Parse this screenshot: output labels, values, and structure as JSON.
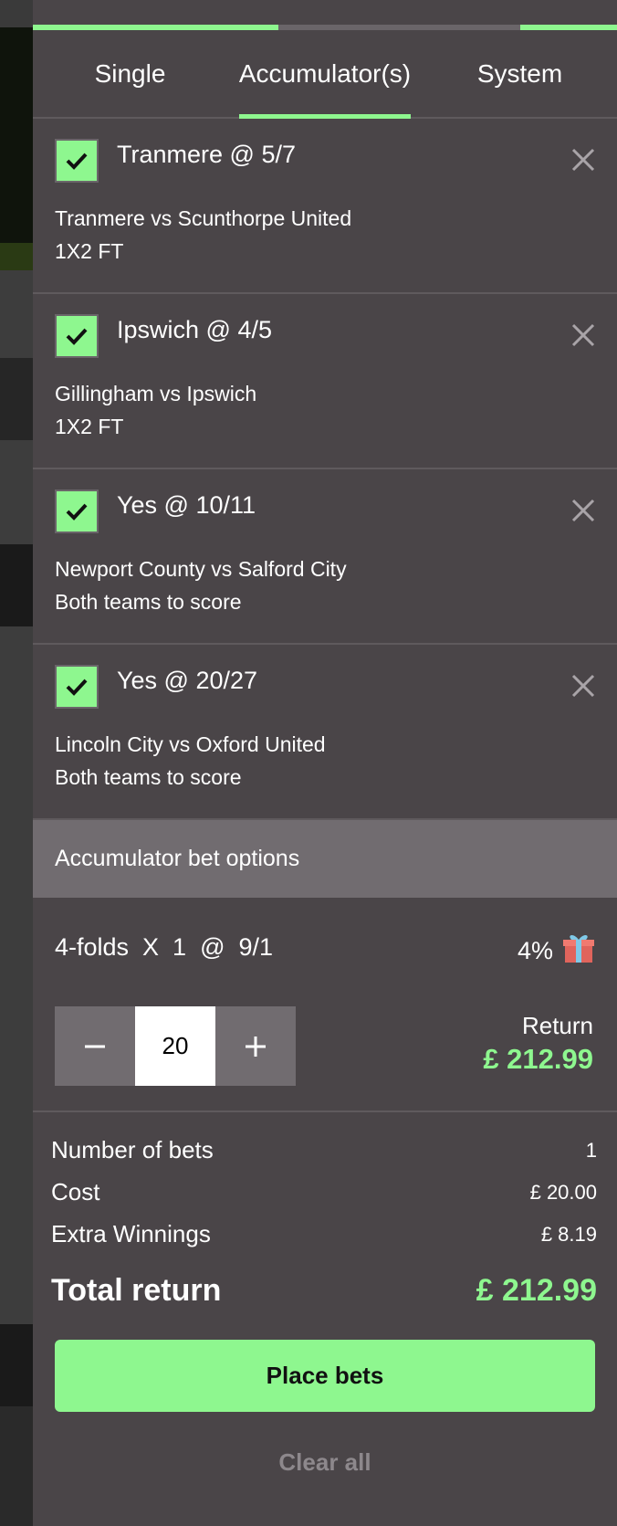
{
  "tabs": [
    {
      "label": "Single"
    },
    {
      "label": "Accumulator(s)"
    },
    {
      "label": "System"
    }
  ],
  "active_tab": "Accumulator(s)",
  "colors": {
    "accent": "#8ef78f",
    "panel": "#4a4548",
    "section_header": "#716c70"
  },
  "selections": [
    {
      "title": "Tranmere @ 5/7",
      "event": "Tranmere vs Scunthorpe United",
      "market": "1X2 FT",
      "checked": true
    },
    {
      "title": "Ipswich @ 4/5",
      "event": "Gillingham vs Ipswich",
      "market": "1X2 FT",
      "checked": true
    },
    {
      "title": "Yes @ 10/11",
      "event": "Newport County vs Salford City",
      "market": "Both teams to score",
      "checked": true
    },
    {
      "title": "Yes @ 20/27",
      "event": "Lincoln City vs Oxford United",
      "market": "Both teams to score",
      "checked": true
    }
  ],
  "acc_options": {
    "header": "Accumulator bet options",
    "folds": "4-folds  X  1  @  9/1",
    "boost": "4%",
    "stake": "20",
    "return_label": "Return",
    "return_value": "£ 212.99"
  },
  "summary": {
    "number_of_bets_label": "Number of bets",
    "number_of_bets": "1",
    "cost_label": "Cost",
    "cost": "£ 20.00",
    "extra_label": "Extra Winnings",
    "extra": "£ 8.19",
    "total_label": "Total return",
    "total": "£ 212.99"
  },
  "actions": {
    "place": "Place bets",
    "clear": "Clear all"
  },
  "icons": {
    "check": "check-icon",
    "close": "close-icon",
    "gift": "gift-icon",
    "minus": "minus-icon",
    "plus": "plus-icon"
  }
}
